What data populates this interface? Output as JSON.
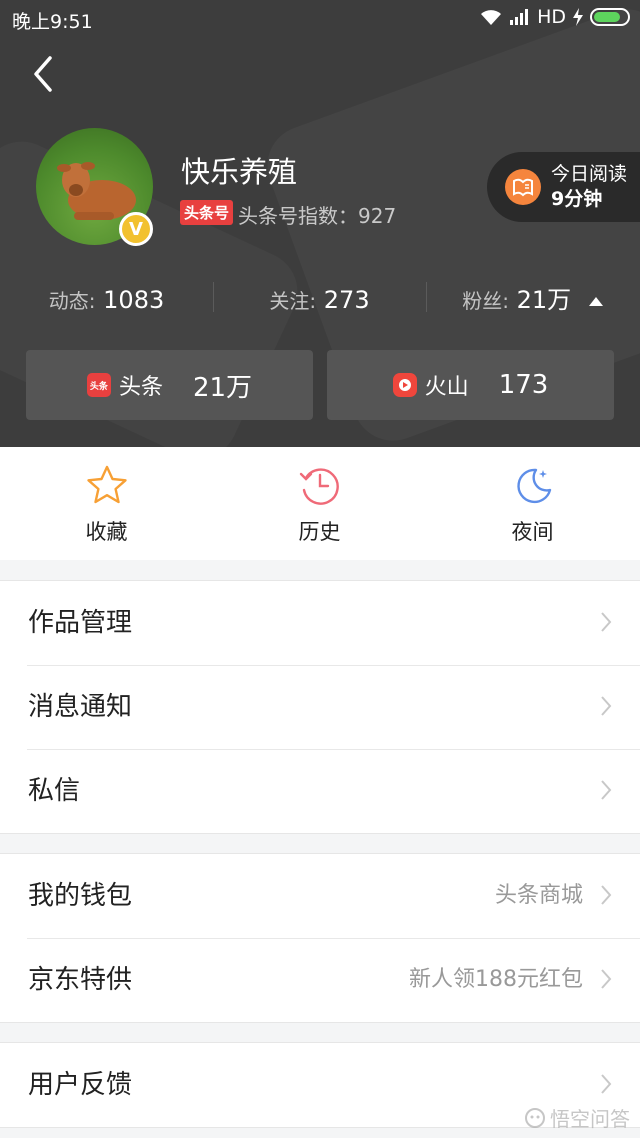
{
  "status_bar": {
    "time": "晚上9:51",
    "network": "HD"
  },
  "profile": {
    "name": "快乐养殖",
    "tag": "头条号",
    "index_text": "头条号指数：927",
    "verified_badge": "V"
  },
  "reading": {
    "line1": "今日阅读",
    "line2": "9分钟"
  },
  "stats": [
    {
      "label": "动态:",
      "value": "1083"
    },
    {
      "label": "关注:",
      "value": "273"
    },
    {
      "label": "粉丝:",
      "value": "21万"
    }
  ],
  "platforms": [
    {
      "icon": "toutiao-logo",
      "icon_text": "头条",
      "name": "头条",
      "value": "21万",
      "color": "#e8403f"
    },
    {
      "icon": "huoshan-logo",
      "name": "火山",
      "value": "173",
      "color": "#f0463c"
    }
  ],
  "quick_actions": [
    {
      "icon": "star-icon",
      "label": "收藏",
      "color": "#f7a035"
    },
    {
      "icon": "history-clock-icon",
      "label": "历史",
      "color": "#ef6a78"
    },
    {
      "icon": "moon-icon",
      "label": "夜间",
      "color": "#5e8ee8"
    }
  ],
  "menu_groups": [
    [
      {
        "title": "作品管理",
        "extra": ""
      },
      {
        "title": "消息通知",
        "extra": ""
      },
      {
        "title": "私信",
        "extra": ""
      }
    ],
    [
      {
        "title": "我的钱包",
        "extra": "头条商城"
      },
      {
        "title": "京东特供",
        "extra": "新人领188元红包"
      }
    ],
    [
      {
        "title": "用户反馈",
        "extra": ""
      }
    ]
  ],
  "watermark": "悟空问答"
}
